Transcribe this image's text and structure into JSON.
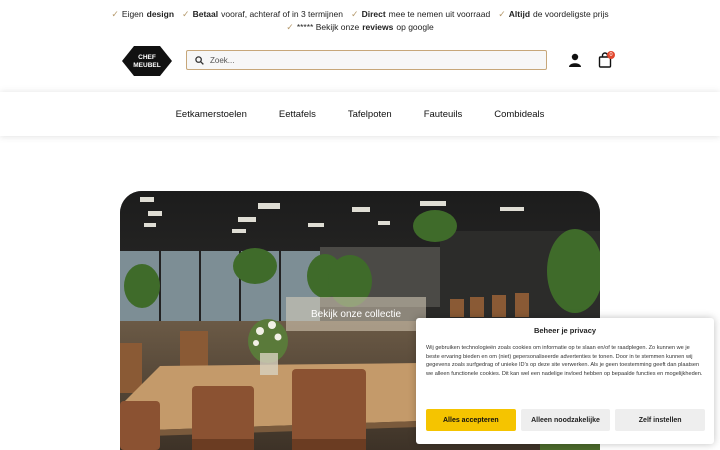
{
  "usps": {
    "row1": [
      {
        "pre": "Eigen ",
        "bold": "design",
        "post": ""
      },
      {
        "pre": "",
        "bold": "Betaal",
        "post": " vooraf, achteraf of in 3 termijnen"
      },
      {
        "pre": "",
        "bold": "Direct",
        "post": " mee te nemen uit voorraad"
      },
      {
        "pre": "",
        "bold": "Altijd",
        "post": " de voordeligste prijs"
      }
    ],
    "row2": {
      "pre": "***** Bekijk onze ",
      "bold": "reviews",
      "post": " op google"
    },
    "check_icon": "check-icon",
    "check_color": "#b69a6d"
  },
  "header": {
    "logo_line1": "CHEF",
    "logo_line2": "MEUBEL",
    "search_placeholder": "Zoek...",
    "cart_count": "0",
    "accent_color": "#c7a77a"
  },
  "nav": {
    "items": [
      "Eetkamerstoelen",
      "Eettafels",
      "Tafelpoten",
      "Fauteuils",
      "Combideals"
    ]
  },
  "hero": {
    "button_label": "Bekijk onze collectie"
  },
  "cookie": {
    "title": "Beheer je privacy",
    "text": "Wij gebruiken technologieën zoals cookies om informatie op te slaan en/of te raadplegen. Zo kunnen we je beste ervaring bieden en om (niet) gepersonaliseerde advertenties te tonen. Door in te stemmen kunnen wij gegevens zoals surfgedrag of unieke ID's op deze site verwerken. Als je geen toestemming geeft dan plaatsen we alleen functionele cookies. Dit kan wel een nadelige invloed hebben op bepaalde functies en mogelijkheden.",
    "accept_label": "Alles accepteren",
    "necessary_label": "Alleen noodzakelijke",
    "settings_label": "Zelf instellen",
    "accept_color": "#f5c400"
  }
}
